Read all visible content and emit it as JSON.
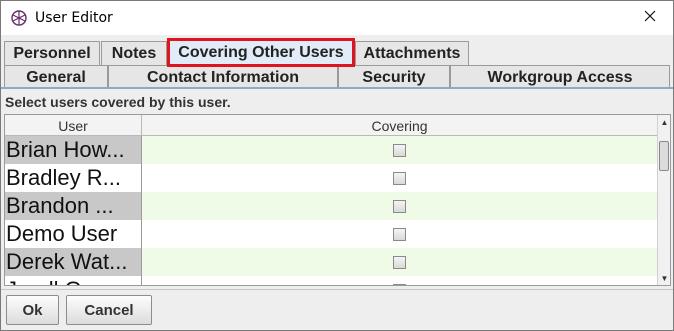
{
  "window": {
    "title": "User Editor"
  },
  "tabs": {
    "row1": [
      "Personnel",
      "Notes",
      "Covering Other Users",
      "Attachments"
    ],
    "row2": [
      "General",
      "Contact Information",
      "Security",
      "Workgroup Access"
    ],
    "selected": "Covering Other Users"
  },
  "panel": {
    "instruction": "Select users covered by this user.",
    "columns": {
      "user": "User",
      "covering": "Covering"
    },
    "rows": [
      {
        "user": "Brian How...",
        "covering": false
      },
      {
        "user": "Bradley R...",
        "covering": false
      },
      {
        "user": "Brandon ...",
        "covering": false
      },
      {
        "user": "Demo User",
        "covering": false
      },
      {
        "user": "Derek Wat...",
        "covering": false
      },
      {
        "user": "Jarell G...",
        "covering": false
      }
    ]
  },
  "footer": {
    "ok_label": "Ok",
    "cancel_label": "Cancel"
  },
  "colors": {
    "selected_tab_highlight": "#e0141e",
    "covering_row_tint": "#f0fbe7"
  }
}
